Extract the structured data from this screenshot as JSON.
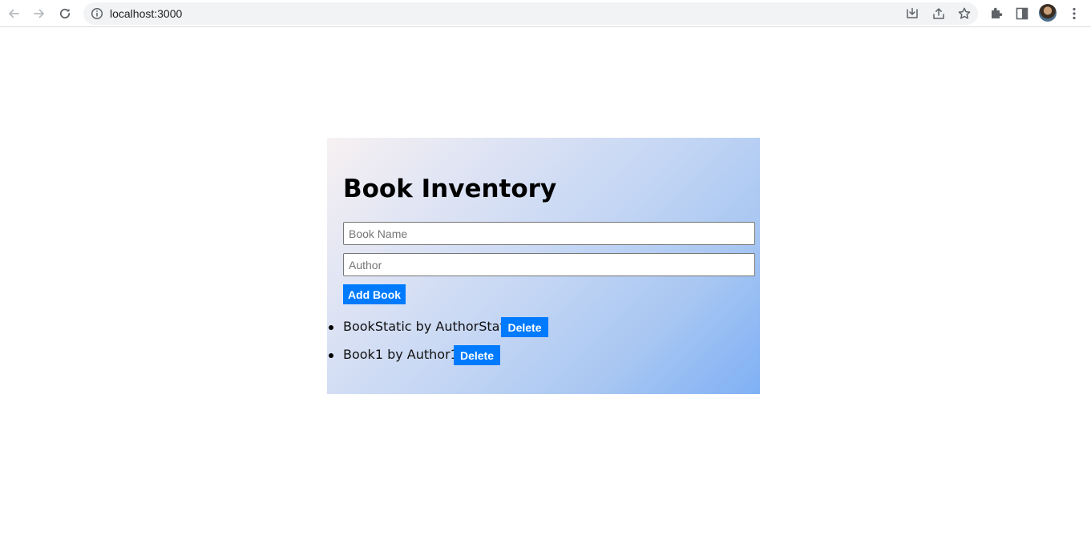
{
  "browser": {
    "url": "localhost:3000"
  },
  "app": {
    "title": "Book Inventory",
    "book_name_placeholder": "Book Name",
    "author_placeholder": "Author",
    "add_button_label": "Add Book",
    "books": [
      {
        "text": "BookStatic by AuthorStatic",
        "delete_label": "Delete"
      },
      {
        "text": "Book1 by Author1",
        "delete_label": "Delete"
      }
    ]
  },
  "colors": {
    "button_bg": "#007bff",
    "gradient_start": "#f7f1f2",
    "gradient_end": "#7fb0f5"
  }
}
